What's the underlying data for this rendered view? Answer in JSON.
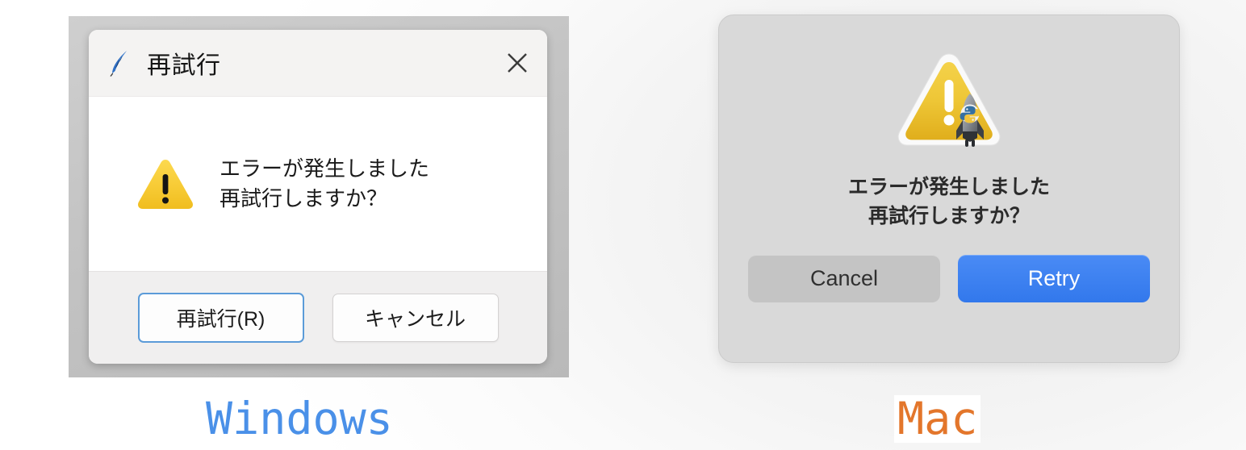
{
  "page": {
    "background_color": "#ffffff"
  },
  "windows_dialog": {
    "platform_caption": "Windows",
    "platform_caption_color": "#4a90e8",
    "titlebar": {
      "app_icon": "tk-feather-icon",
      "title": "再試行",
      "close_label": "✕"
    },
    "content": {
      "icon": "warning-triangle-icon",
      "message_line1": "エラーが発生しました",
      "message_line2": "再試行しますか？"
    },
    "buttons": [
      {
        "label": "再試行(R)",
        "default": true,
        "focus_color": "#5b9bd8"
      },
      {
        "label": "キャンセル",
        "default": false
      }
    ]
  },
  "mac_dialog": {
    "platform_caption": "Mac",
    "platform_caption_color": "#e3762b",
    "content": {
      "icon": "caution-triangle-with-python-rocket-icon",
      "message_line1": "エラーが発生しました",
      "message_line2": "再試行しますか？"
    },
    "buttons": [
      {
        "label": "Cancel",
        "default": false,
        "color": "#c4c4c4"
      },
      {
        "label": "Retry",
        "default": true,
        "color": "#3278ec"
      }
    ]
  }
}
